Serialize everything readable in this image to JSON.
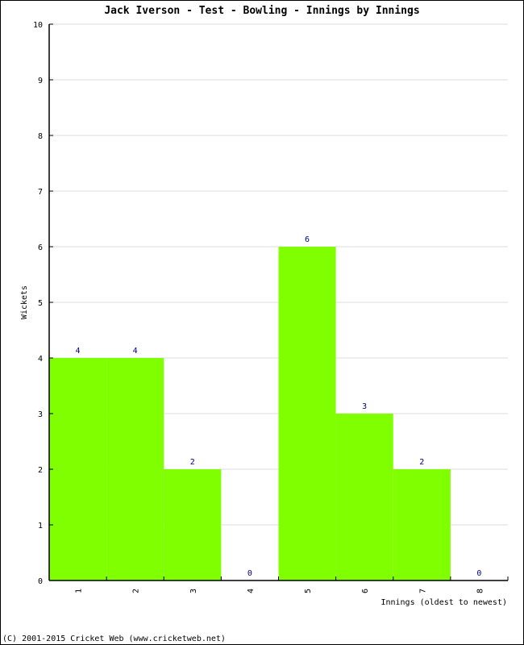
{
  "chart_data": {
    "type": "bar",
    "title": "Jack Iverson - Test - Bowling - Innings by Innings",
    "xlabel": "Innings (oldest to newest)",
    "ylabel": "Wickets",
    "categories": [
      "1",
      "2",
      "3",
      "4",
      "5",
      "6",
      "7",
      "8"
    ],
    "values": [
      4,
      4,
      2,
      0,
      6,
      3,
      2,
      0
    ],
    "data_labels": [
      "4",
      "4",
      "2",
      "0",
      "6",
      "3",
      "2",
      "0"
    ],
    "ylim": [
      0,
      10
    ],
    "yticks": [
      "0",
      "1",
      "2",
      "3",
      "4",
      "5",
      "6",
      "7",
      "8",
      "9",
      "10"
    ],
    "grid": true,
    "bar_color": "#80ff00",
    "label_color": "#000080",
    "grid_color": "#dddddd"
  },
  "footer": "(C) 2001-2015 Cricket Web (www.cricketweb.net)"
}
